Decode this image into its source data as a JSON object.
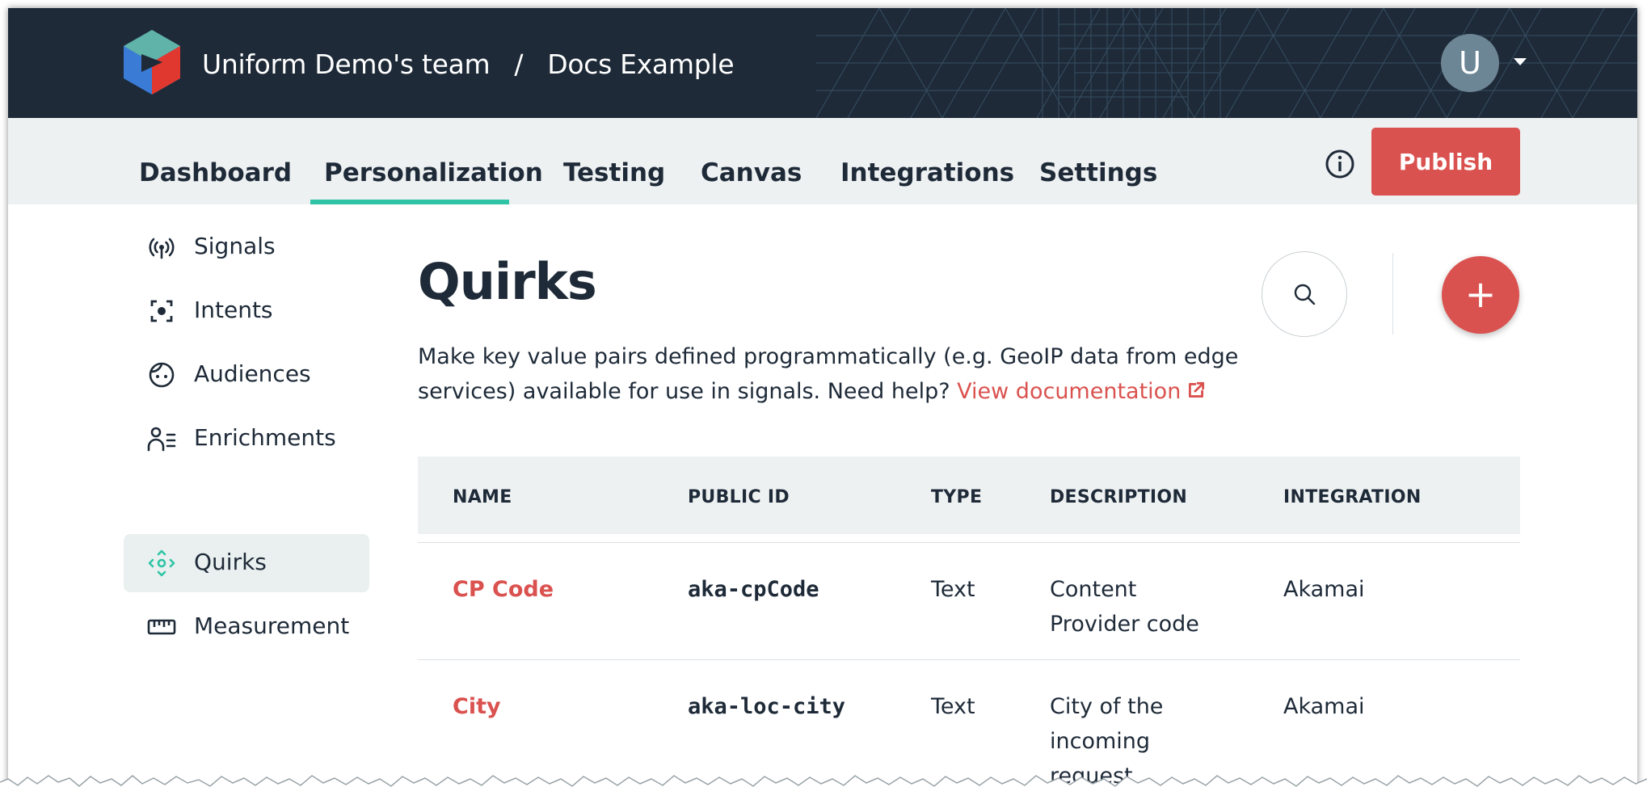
{
  "header": {
    "team_name": "Uniform Demo's team",
    "separator": "/",
    "project_name": "Docs Example",
    "avatar_initial": "U"
  },
  "nav": {
    "tabs": [
      {
        "label": "Dashboard",
        "active": false
      },
      {
        "label": "Personalization",
        "active": true
      },
      {
        "label": "Testing",
        "active": false
      },
      {
        "label": "Canvas",
        "active": false
      },
      {
        "label": "Integrations",
        "active": false
      },
      {
        "label": "Settings",
        "active": false
      }
    ],
    "publish_label": "Publish"
  },
  "sidebar": {
    "items": [
      {
        "label": "Signals",
        "icon": "signals-icon",
        "active": false
      },
      {
        "label": "Intents",
        "icon": "intents-icon",
        "active": false
      },
      {
        "label": "Audiences",
        "icon": "audiences-icon",
        "active": false
      },
      {
        "label": "Enrichments",
        "icon": "enrichments-icon",
        "active": false
      },
      {
        "label": "Quirks",
        "icon": "quirks-icon",
        "active": true
      },
      {
        "label": "Measurement",
        "icon": "measurement-icon",
        "active": false
      }
    ]
  },
  "main": {
    "title": "Quirks",
    "description": "Make key value pairs defined programmatically (e.g. GeoIP data from edge services) available for use in signals. Need help?",
    "doc_link": "View documentation",
    "add_label": "+"
  },
  "table": {
    "columns": [
      "NAME",
      "PUBLIC ID",
      "TYPE",
      "DESCRIPTION",
      "INTEGRATION"
    ],
    "rows": [
      {
        "name": "CP Code",
        "public_id": "aka-cpCode",
        "type": "Text",
        "description": "Content Provider code",
        "integration": "Akamai"
      },
      {
        "name": "City",
        "public_id": "aka-loc-city",
        "type": "Text",
        "description": "City of the incoming request",
        "integration": "Akamai"
      }
    ]
  },
  "colors": {
    "header_bg": "#1e2a38",
    "accent_red": "#da524f",
    "tab_underline": "#2ec4a5",
    "nav_bg": "#eef1f2"
  }
}
